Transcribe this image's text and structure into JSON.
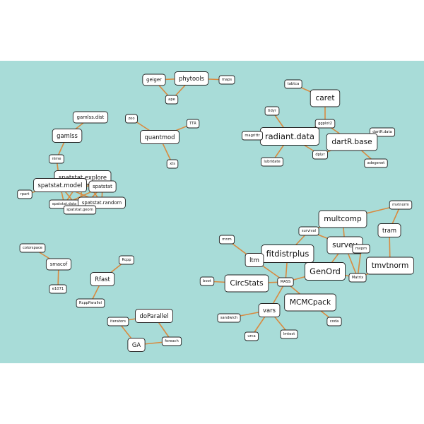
{
  "colors": {
    "background": "#a8dcd8",
    "edge": "#d98a3f",
    "node_fill": "#ffffff",
    "node_border": "#222222"
  },
  "nodes": [
    {
      "id": "geiger",
      "label": "geiger"
    },
    {
      "id": "phytools",
      "label": "phytools"
    },
    {
      "id": "maps",
      "label": "maps"
    },
    {
      "id": "ape",
      "label": "ape"
    },
    {
      "id": "tableau",
      "label": "tabtca"
    },
    {
      "id": "caret",
      "label": "caret"
    },
    {
      "id": "tidyr",
      "label": "tidyr"
    },
    {
      "id": "ggplot2",
      "label": "ggplot2"
    },
    {
      "id": "radiant_data",
      "label": "radiant.data"
    },
    {
      "id": "magrittr",
      "label": "magrittr"
    },
    {
      "id": "dartR_data",
      "label": "dartR.data"
    },
    {
      "id": "dartR_base",
      "label": "dartR.base"
    },
    {
      "id": "dplyr",
      "label": "dplyr"
    },
    {
      "id": "lubridate",
      "label": "lubridate"
    },
    {
      "id": "adegenet",
      "label": "adegenet"
    },
    {
      "id": "zoo",
      "label": "zoo"
    },
    {
      "id": "TTR",
      "label": "TTR"
    },
    {
      "id": "quantmod",
      "label": "quantmod"
    },
    {
      "id": "xts",
      "label": "xts"
    },
    {
      "id": "gamlss_dist",
      "label": "gamlss.dist"
    },
    {
      "id": "gamlss",
      "label": "gamlss"
    },
    {
      "id": "nlme",
      "label": "nlme"
    },
    {
      "id": "spatstat_explore",
      "label": "spatstat.explore"
    },
    {
      "id": "spatstat_model",
      "label": "spatstat.model"
    },
    {
      "id": "spatstat",
      "label": "spatstat"
    },
    {
      "id": "rpart",
      "label": "rpart"
    },
    {
      "id": "spatstat_data",
      "label": "spatstat.data"
    },
    {
      "id": "spatstat_random",
      "label": "spatstat.random"
    },
    {
      "id": "spatstat_geom",
      "label": "spatstat.geom"
    },
    {
      "id": "multcomp",
      "label": "multcomp"
    },
    {
      "id": "mvtnorm_top",
      "label": "mvtnorm"
    },
    {
      "id": "tram",
      "label": "tram"
    },
    {
      "id": "survival",
      "label": "survival"
    },
    {
      "id": "mnm",
      "label": "mnm"
    },
    {
      "id": "fitdistrplus",
      "label": "fitdistrplus"
    },
    {
      "id": "survey",
      "label": "survey"
    },
    {
      "id": "mvpm",
      "label": "mvpm"
    },
    {
      "id": "ltm",
      "label": "ltm"
    },
    {
      "id": "GenOrd",
      "label": "GenOrd"
    },
    {
      "id": "tmvtnorm",
      "label": "tmvtnorm"
    },
    {
      "id": "Matrix",
      "label": "Matrix"
    },
    {
      "id": "boot",
      "label": "boot"
    },
    {
      "id": "CircStats",
      "label": "CircStats"
    },
    {
      "id": "MASS",
      "label": "MASS"
    },
    {
      "id": "MCMCpack",
      "label": "MCMCpack"
    },
    {
      "id": "vars",
      "label": "vars"
    },
    {
      "id": "sandwich",
      "label": "sandwich"
    },
    {
      "id": "coda",
      "label": "coda"
    },
    {
      "id": "urca",
      "label": "urca"
    },
    {
      "id": "lmtest",
      "label": "lmtest"
    },
    {
      "id": "colorspace",
      "label": "colorspace"
    },
    {
      "id": "smacof",
      "label": "smacof"
    },
    {
      "id": "e1071",
      "label": "e1071"
    },
    {
      "id": "Rcpp",
      "label": "Rcpp"
    },
    {
      "id": "Rfast",
      "label": "Rfast"
    },
    {
      "id": "RcppParallel",
      "label": "RcppParallel"
    },
    {
      "id": "doParallel",
      "label": "doParallel"
    },
    {
      "id": "iterators",
      "label": "iterators"
    },
    {
      "id": "GA",
      "label": "GA"
    },
    {
      "id": "foreach",
      "label": "foreach"
    }
  ],
  "edges": [
    [
      "geiger",
      "phytools"
    ],
    [
      "phytools",
      "maps"
    ],
    [
      "geiger",
      "ape"
    ],
    [
      "phytools",
      "ape"
    ],
    [
      "tableau",
      "caret"
    ],
    [
      "caret",
      "ggplot2"
    ],
    [
      "tidyr",
      "radiant_data"
    ],
    [
      "ggplot2",
      "radiant_data"
    ],
    [
      "ggplot2",
      "dartR_base"
    ],
    [
      "magrittr",
      "radiant_data"
    ],
    [
      "radiant_data",
      "lubridate"
    ],
    [
      "radiant_data",
      "dplyr"
    ],
    [
      "dplyr",
      "dartR_base"
    ],
    [
      "dartR_data",
      "dartR_base"
    ],
    [
      "dartR_base",
      "adegenet"
    ],
    [
      "zoo",
      "quantmod"
    ],
    [
      "TTR",
      "quantmod"
    ],
    [
      "quantmod",
      "xts"
    ],
    [
      "gamlss_dist",
      "gamlss"
    ],
    [
      "gamlss",
      "nlme"
    ],
    [
      "nlme",
      "spatstat_model"
    ],
    [
      "spatstat_explore",
      "spatstat_model"
    ],
    [
      "spatstat_explore",
      "spatstat"
    ],
    [
      "spatstat_explore",
      "spatstat_data"
    ],
    [
      "spatstat_explore",
      "spatstat_random"
    ],
    [
      "spatstat_explore",
      "spatstat_geom"
    ],
    [
      "spatstat_model",
      "spatstat"
    ],
    [
      "spatstat_model",
      "rpart"
    ],
    [
      "spatstat_model",
      "spatstat_data"
    ],
    [
      "spatstat_model",
      "spatstat_random"
    ],
    [
      "spatstat_model",
      "spatstat_geom"
    ],
    [
      "spatstat",
      "spatstat_data"
    ],
    [
      "spatstat",
      "spatstat_random"
    ],
    [
      "spatstat",
      "spatstat_geom"
    ],
    [
      "spatstat_data",
      "spatstat_random"
    ],
    [
      "spatstat_data",
      "spatstat_geom"
    ],
    [
      "spatstat_random",
      "spatstat_geom"
    ],
    [
      "multcomp",
      "survival"
    ],
    [
      "multcomp",
      "mvtnorm_top"
    ],
    [
      "multcomp",
      "survey"
    ],
    [
      "mvtnorm_top",
      "tram"
    ],
    [
      "tram",
      "tmvtnorm"
    ],
    [
      "survival",
      "fitdistrplus"
    ],
    [
      "survival",
      "survey"
    ],
    [
      "survey",
      "mvpm"
    ],
    [
      "survey",
      "GenOrd"
    ],
    [
      "survey",
      "Matrix"
    ],
    [
      "mvpm",
      "Matrix"
    ],
    [
      "tmvtnorm",
      "Matrix"
    ],
    [
      "GenOrd",
      "Matrix"
    ],
    [
      "mnm",
      "ltm"
    ],
    [
      "ltm",
      "MASS"
    ],
    [
      "fitdistrplus",
      "MASS"
    ],
    [
      "GenOrd",
      "MASS"
    ],
    [
      "boot",
      "CircStats"
    ],
    [
      "CircStats",
      "MASS"
    ],
    [
      "MASS",
      "MCMCpack"
    ],
    [
      "MASS",
      "vars"
    ],
    [
      "MCMCpack",
      "coda"
    ],
    [
      "vars",
      "sandwich"
    ],
    [
      "vars",
      "urca"
    ],
    [
      "vars",
      "lmtest"
    ],
    [
      "colorspace",
      "smacof"
    ],
    [
      "smacof",
      "e1071"
    ],
    [
      "Rcpp",
      "Rfast"
    ],
    [
      "Rfast",
      "RcppParallel"
    ],
    [
      "doParallel",
      "iterators"
    ],
    [
      "doParallel",
      "foreach"
    ],
    [
      "iterators",
      "GA"
    ],
    [
      "GA",
      "foreach"
    ]
  ]
}
